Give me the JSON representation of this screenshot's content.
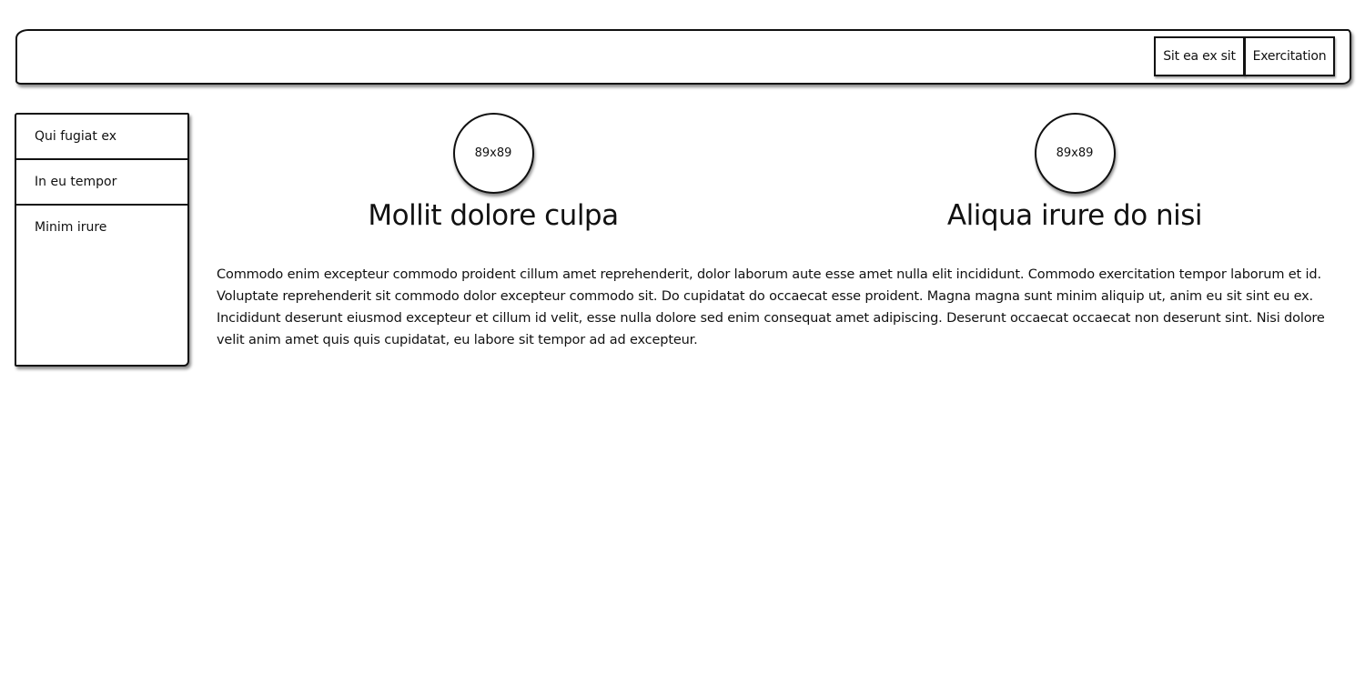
{
  "navbar": {
    "buttons": [
      {
        "label": "Sit ea ex sit"
      },
      {
        "label": "Exercitation"
      }
    ]
  },
  "sidebar": {
    "items": [
      {
        "label": "Qui fugiat ex"
      },
      {
        "label": "In eu tempor"
      },
      {
        "label": "Minim irure"
      }
    ]
  },
  "features": [
    {
      "image_label": "89x89",
      "title": "Mollit dolore culpa"
    },
    {
      "image_label": "89x89",
      "title": "Aliqua irure do nisi"
    }
  ],
  "main": {
    "paragraph": "Commodo enim excepteur commodo proident cillum amet reprehenderit, dolor laborum aute esse amet nulla elit incididunt. Commodo exercitation tempor laborum et id. Voluptate reprehenderit sit commodo dolor excepteur commodo sit. Do cupidatat do occaecat esse proident. Magna magna sunt minim aliquip ut, anim eu sit sint eu ex. Incididunt deserunt eiusmod excepteur et cillum id velit, esse nulla dolore sed enim consequat amet adipiscing. Deserunt occaecat occaecat non deserunt sint. Nisi dolore velit anim amet quis quis cupidatat, eu labore sit tempor ad ad excepteur."
  }
}
